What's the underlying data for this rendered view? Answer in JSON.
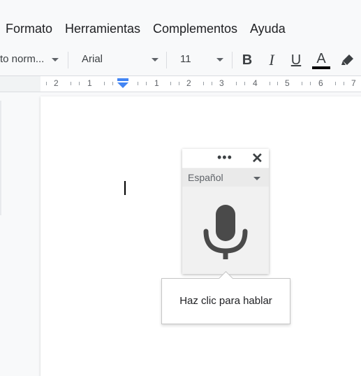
{
  "menu": {
    "items": [
      "Formato",
      "Herramientas",
      "Complementos",
      "Ayuda"
    ]
  },
  "toolbar": {
    "style_value": "to norm...",
    "font_value": "Arial",
    "size_value": "11",
    "bold_label": "B",
    "italic_label": "I",
    "underline_label": "U",
    "text_color_label": "A",
    "text_color": "#000000",
    "highlight_icon": "highlighter-icon"
  },
  "ruler": {
    "labels": [
      "2",
      "1",
      "1",
      "2",
      "3",
      "4",
      "5",
      "6",
      "7"
    ]
  },
  "voice_typing": {
    "menu_icon": "more-options-icon",
    "close_icon": "close-icon",
    "language": "Español",
    "mic_icon": "microphone-icon",
    "mic_color": "#4a4a4a",
    "tooltip": "Haz clic para hablar"
  },
  "accent_color": "#4285f4"
}
